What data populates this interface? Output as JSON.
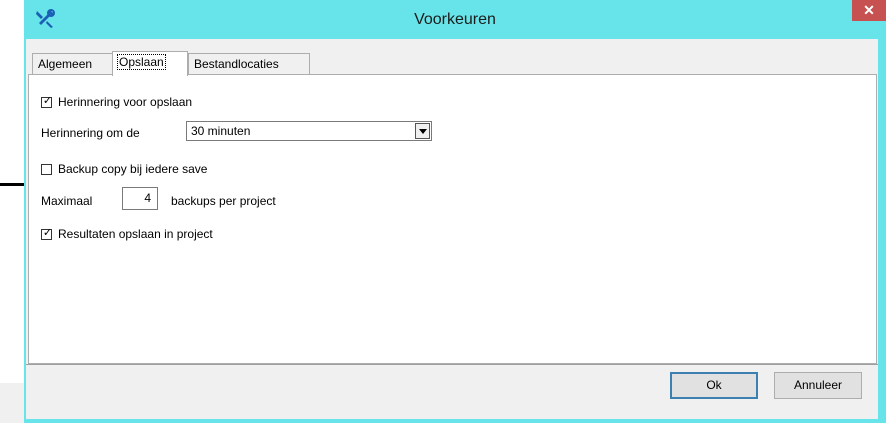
{
  "window": {
    "title": "Voorkeuren",
    "close_glyph": "✕",
    "icon": "tools-icon"
  },
  "tabs": [
    {
      "label": "Algemeen",
      "active": false
    },
    {
      "label": "Opslaan",
      "active": true
    },
    {
      "label": "Bestandlocaties",
      "active": false
    }
  ],
  "opslaan": {
    "reminder_checkbox": {
      "label": "Herinnering voor opslaan",
      "checked": true
    },
    "reminder_interval": {
      "label": "Herinnering om de",
      "value": "30 minuten"
    },
    "backup_checkbox": {
      "label": "Backup copy bij iedere save",
      "checked": false
    },
    "max_backups": {
      "label": "Maximaal",
      "value": "4",
      "suffix": "backups per project"
    },
    "results_checkbox": {
      "label": "Resultaten opslaan in project",
      "checked": true
    }
  },
  "buttons": {
    "ok": "Ok",
    "cancel": "Annuleer"
  },
  "colors": {
    "titlebar": "#67e4e9",
    "close": "#c75050"
  }
}
